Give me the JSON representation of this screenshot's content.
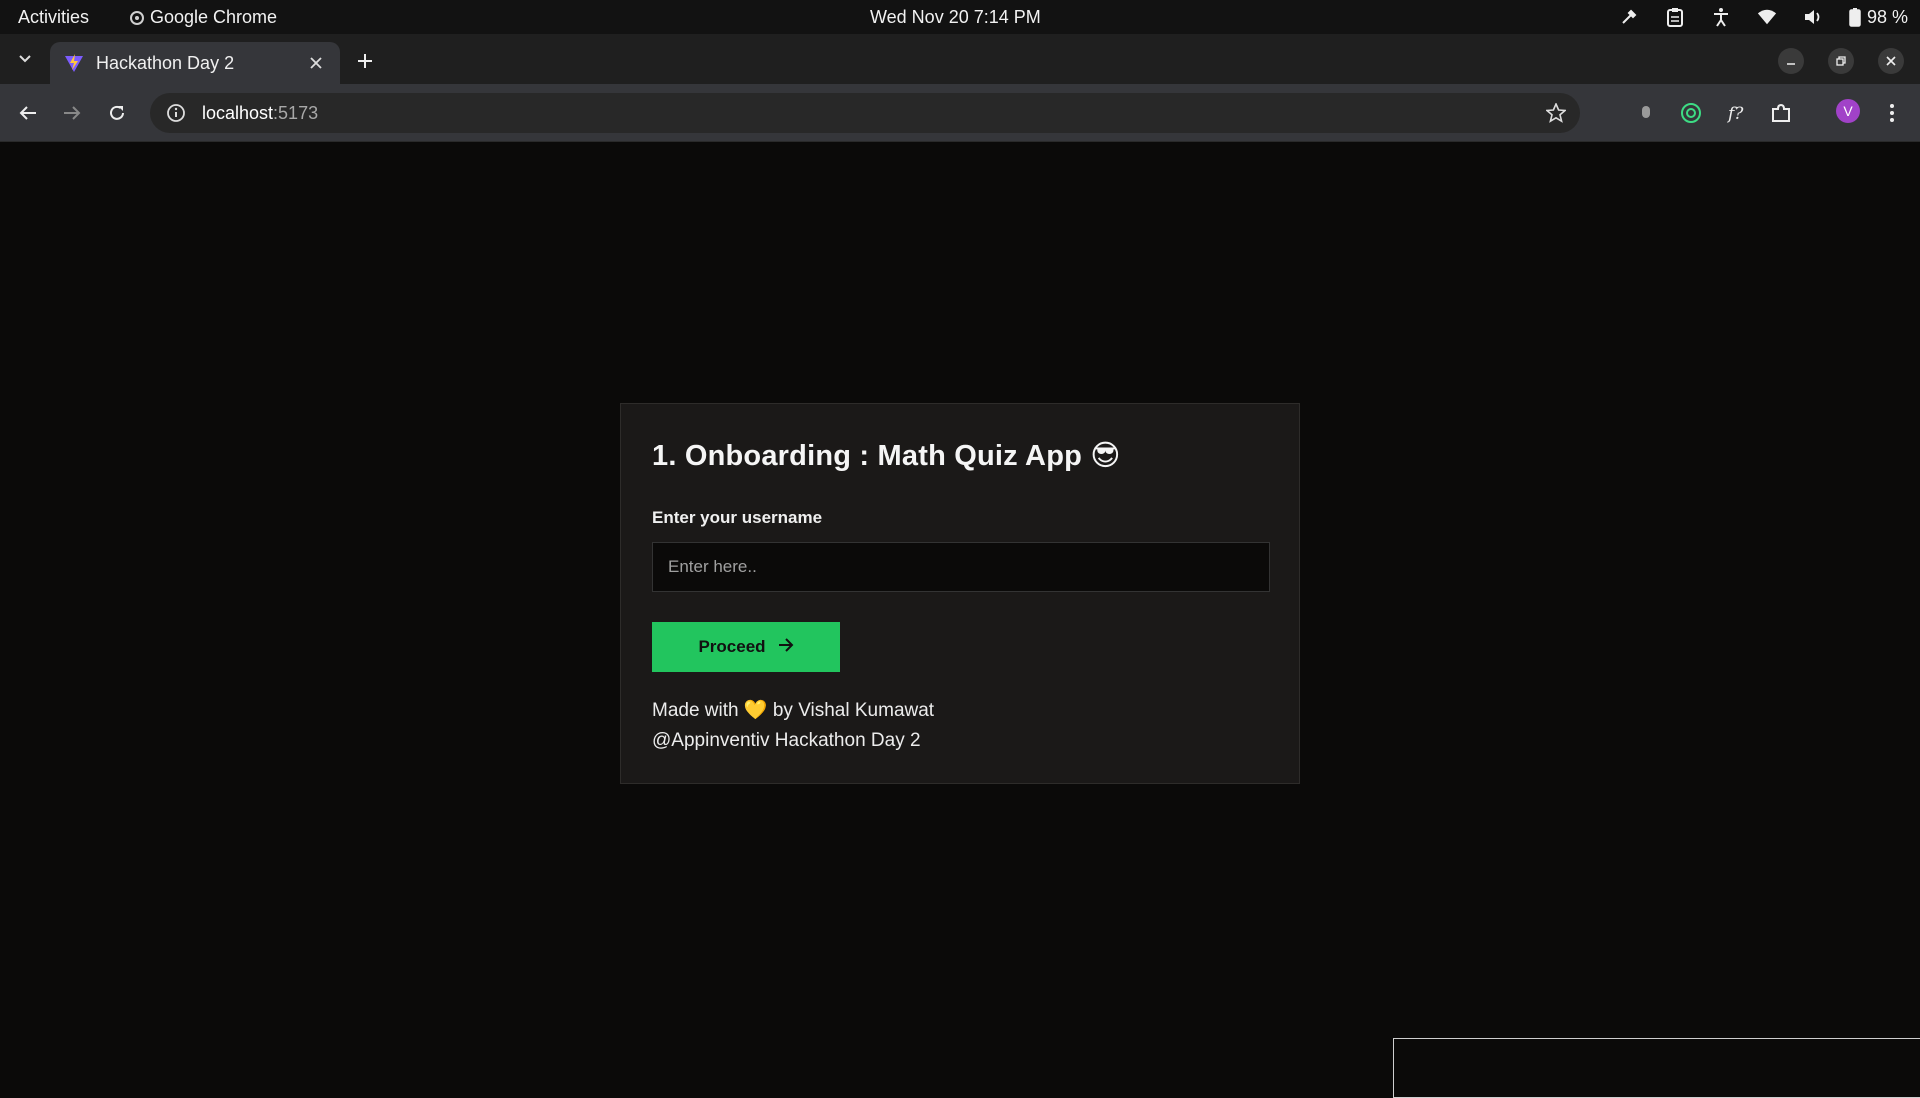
{
  "system": {
    "activities": "Activities",
    "app_name": "Google Chrome",
    "clock": "Wed Nov 20  7:14 PM",
    "battery": "98 %"
  },
  "browser": {
    "tab_title": "Hackathon Day 2",
    "url_host": "localhost",
    "url_port": ":5173",
    "profile_initial": "V"
  },
  "page": {
    "heading": "1. Onboarding : Math Quiz App 😎",
    "username_label": "Enter your username",
    "username_placeholder": "Enter here..",
    "username_value": "",
    "proceed_label": "Proceed",
    "footer_prefix": "Made with",
    "footer_heart": "💛",
    "footer_suffix": "by Vishal Kumawat",
    "footer_line2": "@Appinventiv Hackathon Day 2"
  },
  "colors": {
    "accent_green": "#22c55e",
    "card_bg": "#1b1918",
    "page_bg": "#0b0a09",
    "profile_purple": "#a142c8"
  }
}
